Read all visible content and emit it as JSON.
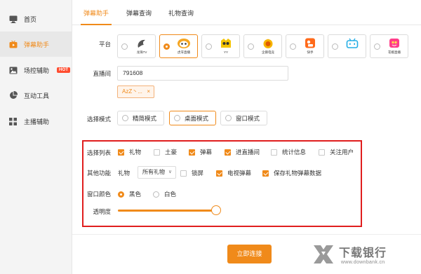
{
  "sidebar": {
    "items": [
      {
        "label": "首页",
        "icon": "monitor-icon"
      },
      {
        "label": "弹幕助手",
        "icon": "tv-icon",
        "active": true
      },
      {
        "label": "场控辅助",
        "icon": "image-icon",
        "badge": "HOT"
      },
      {
        "label": "互动工具",
        "icon": "chart-pie-icon"
      },
      {
        "label": "主播辅助",
        "icon": "grid-icon"
      }
    ]
  },
  "tabs": [
    "弹幕助手",
    "弹幕查询",
    "礼物查询"
  ],
  "platform": {
    "label": "平台",
    "options": [
      {
        "name": "龙珠TV",
        "selected": false
      },
      {
        "name": "虎牙直播",
        "selected": true
      },
      {
        "name": "YY",
        "selected": false
      },
      {
        "name": "企鹅电竞",
        "selected": false
      },
      {
        "name": "快手",
        "selected": false
      },
      {
        "name": "bilibili",
        "selected": false
      },
      {
        "name": "花椒直播",
        "selected": false
      }
    ]
  },
  "room": {
    "label": "直播间",
    "value": "791608",
    "tag": "AzZ丶...",
    "tag_close": "×"
  },
  "mode": {
    "label": "选择模式",
    "options": [
      {
        "label": "精简模式",
        "selected": false
      },
      {
        "label": "桌面模式",
        "selected": true
      },
      {
        "label": "窗口模式",
        "selected": false
      }
    ]
  },
  "select_list": {
    "label": "选择列表",
    "items": [
      {
        "label": "礼物",
        "checked": true
      },
      {
        "label": "土豪",
        "checked": false
      },
      {
        "label": "弹幕",
        "checked": true
      },
      {
        "label": "进直播间",
        "checked": true
      },
      {
        "label": "统计信息",
        "checked": false
      },
      {
        "label": "关注用户",
        "checked": false
      }
    ]
  },
  "other_functions": {
    "label": "其他功能",
    "gift_label": "礼物",
    "gift_select": "所有礼物",
    "items": [
      {
        "label": "锁屏",
        "checked": false
      },
      {
        "label": "电视弹幕",
        "checked": true
      },
      {
        "label": "保存礼物弹幕数据",
        "checked": true
      }
    ]
  },
  "window_color": {
    "label": "窗口颜色",
    "options": [
      {
        "label": "黑色",
        "selected": true
      },
      {
        "label": "白色",
        "selected": false
      }
    ]
  },
  "opacity": {
    "label": "透明度",
    "value": 1.0
  },
  "connect_button": "立即连接",
  "watermark": {
    "title": "下载银行",
    "url": "www.downbank.cn"
  },
  "colors": {
    "accent": "#f08a1a",
    "highlight_box": "#e01e1e"
  }
}
